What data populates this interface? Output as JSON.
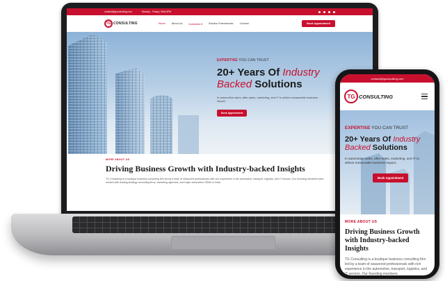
{
  "site": {
    "top_email": "contact@tgconsulting.com",
    "top_hours": "Monday - Friday | 9AM-6PM",
    "logo_mark": "TG",
    "logo_text": "CONSULTING",
    "nav": [
      {
        "label": "Home",
        "active": true
      },
      {
        "label": "About Us",
        "active": false
      },
      {
        "label": "Industries ▾",
        "active": false
      },
      {
        "label": "Solution Frameworks",
        "active": false
      },
      {
        "label": "Contact",
        "active": false
      }
    ],
    "book_label": "Book Appointment",
    "hero": {
      "eyebrow_red": "EXPERTISE",
      "eyebrow_dark": " YOU CAN TRUST",
      "title_a": "20+ Years Of ",
      "title_italic_1": "Industry",
      "title_italic_2": "Backed",
      "title_b": " Solutions",
      "desc": "In automotive sales, after-sales, marketing, and IT to deliver measurable business impact.",
      "button": "Book Appointment"
    },
    "about": {
      "tag": "MORE ABOUT US",
      "title": "Driving Business Growth with Industry-backed Insights",
      "body": "TG Consulting is a boutique business consulting firm led by a team of seasoned professionals with rich experience in the automotive, transport, logistics, and IT sectors. Our founding members have worked with leading strategy consulting firms, marketing agencies, and major automotive OEMs in India.",
      "body_mobile": "TG Consulting is a boutique business consulting firm led by a team of seasoned professionals with rich experience in the automotive, transport, logistics, and IT sectors. Our founding members"
    }
  },
  "colors": {
    "brand_red": "#c8102e",
    "dark": "#1a1a1a",
    "device_black": "#151517"
  }
}
